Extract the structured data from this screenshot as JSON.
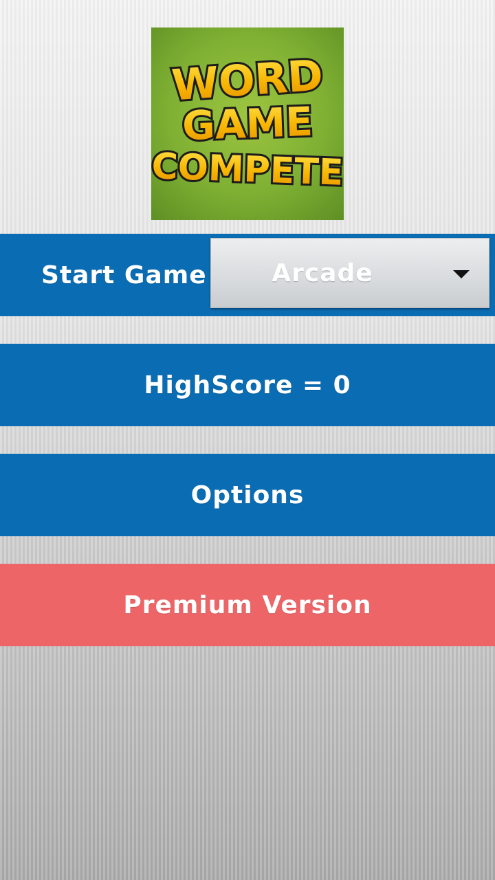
{
  "logo": {
    "line1": "WORD",
    "line2": "GAME",
    "line3": "COMPETE"
  },
  "menu": {
    "start_label": "Start Game",
    "mode_selected": "Arcade",
    "highscore_label": "HighScore = 0",
    "options_label": "Options",
    "premium_label": "Premium Version"
  },
  "colors": {
    "primary_blue": "#0a6cb2",
    "premium_red": "#ed6567",
    "logo_green": "#7fb033",
    "logo_letters": "#f7a900"
  },
  "icons": {
    "dropdown": "chevron-down-icon"
  }
}
